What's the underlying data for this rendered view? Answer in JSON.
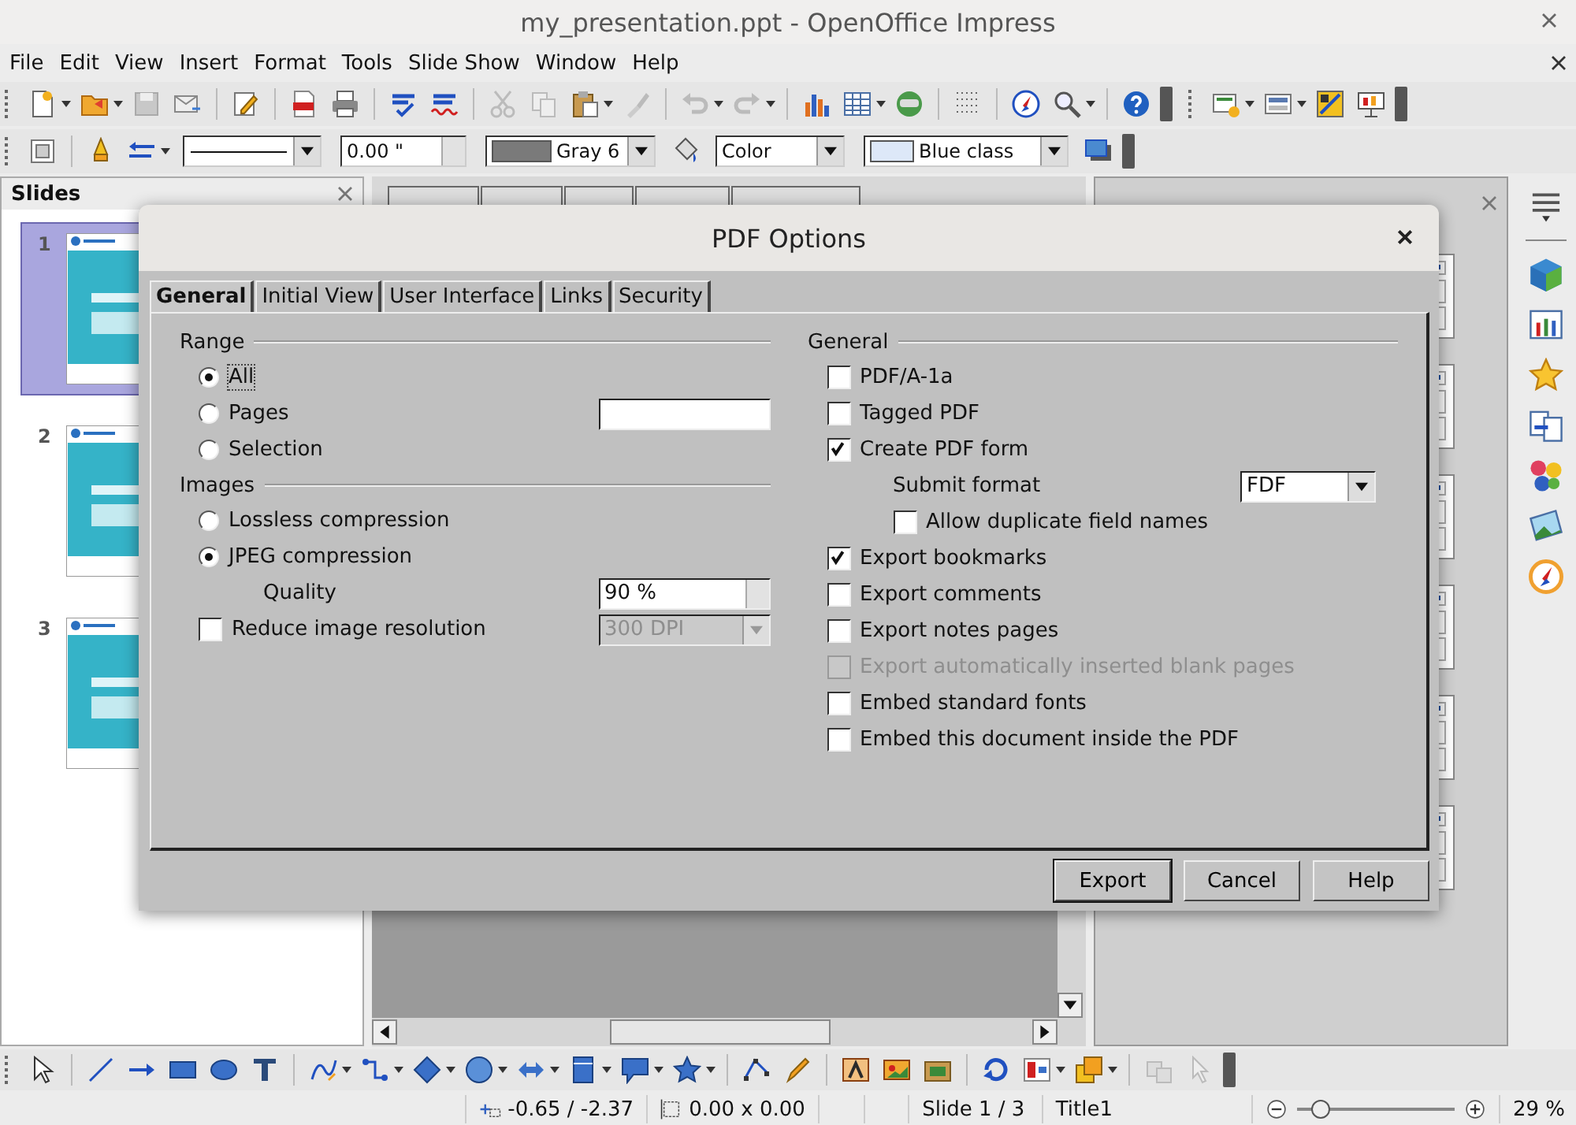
{
  "window": {
    "title": "my_presentation.ppt - OpenOffice Impress"
  },
  "menu": [
    "File",
    "Edit",
    "View",
    "Insert",
    "Format",
    "Tools",
    "Slide Show",
    "Window",
    "Help"
  ],
  "format_bar": {
    "line_width": "0.00 \"",
    "line_color": "Gray 6",
    "area_style": "Color",
    "area_color": "Blue class"
  },
  "slides_panel": {
    "title": "Slides",
    "slides": [
      {
        "number": "1",
        "selected": true
      },
      {
        "number": "2",
        "selected": false
      },
      {
        "number": "3",
        "selected": false
      }
    ]
  },
  "dialog": {
    "title": "PDF Options",
    "tabs": [
      {
        "label": "General",
        "selected": true
      },
      {
        "label": "Initial View",
        "selected": false
      },
      {
        "label": "User Interface",
        "selected": false
      },
      {
        "label": "Links",
        "selected": false
      },
      {
        "label": "Security",
        "selected": false
      }
    ],
    "range": {
      "heading": "Range",
      "options": [
        {
          "label": "All",
          "selected": true
        },
        {
          "label": "Pages",
          "selected": false
        },
        {
          "label": "Selection",
          "selected": false
        }
      ]
    },
    "images": {
      "heading": "Images",
      "options": [
        {
          "label": "Lossless compression",
          "selected": false
        },
        {
          "label": "JPEG compression",
          "selected": true
        }
      ],
      "quality_label": "Quality",
      "quality_value": "90 %",
      "reduce": {
        "label": "Reduce image resolution",
        "checked": false
      },
      "resolution": {
        "value": "300 DPI",
        "disabled": true
      }
    },
    "general": {
      "heading": "General",
      "items": [
        {
          "kind": "check",
          "label": "PDF/A-1a",
          "checked": false,
          "disabled": false
        },
        {
          "kind": "check",
          "label": "Tagged PDF",
          "checked": false,
          "disabled": false
        },
        {
          "kind": "check",
          "label": "Create PDF form",
          "checked": true,
          "disabled": false
        },
        {
          "kind": "select",
          "label": "Submit format",
          "value": "FDF"
        },
        {
          "kind": "subcheck",
          "label": "Allow duplicate field names",
          "checked": false,
          "disabled": false
        },
        {
          "kind": "check",
          "label": "Export bookmarks",
          "checked": true,
          "disabled": false
        },
        {
          "kind": "check",
          "label": "Export comments",
          "checked": false,
          "disabled": false
        },
        {
          "kind": "check",
          "label": "Export notes pages",
          "checked": false,
          "disabled": false
        },
        {
          "kind": "check",
          "label": "Export automatically inserted blank pages",
          "checked": false,
          "disabled": true
        },
        {
          "kind": "check",
          "label": "Embed standard fonts",
          "checked": false,
          "disabled": false
        },
        {
          "kind": "check",
          "label": "Embed this document inside the PDF",
          "checked": false,
          "disabled": false
        }
      ]
    },
    "buttons": [
      {
        "label": "Export",
        "default": true
      },
      {
        "label": "Cancel",
        "default": false
      },
      {
        "label": "Help",
        "default": false
      }
    ]
  },
  "status_bar": {
    "position": "-0.65 / -2.37",
    "size": "0.00 x 0.00",
    "slide": "Slide 1 / 3",
    "layout": "Title1",
    "zoom_slider": {
      "level": 0.15
    },
    "zoom": "29 %"
  }
}
